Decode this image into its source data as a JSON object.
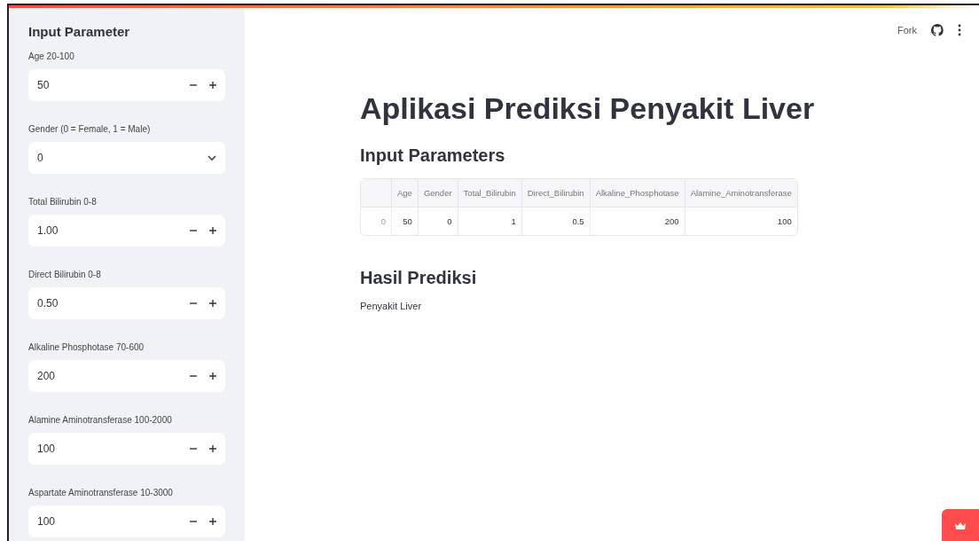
{
  "sidebar": {
    "title": "Input Parameter",
    "fields": [
      {
        "label": "Age 20-100",
        "value": "50",
        "kind": "number"
      },
      {
        "label": "Gender (0 = Female, 1 = Male)",
        "value": "0",
        "kind": "select"
      },
      {
        "label": "Total Bilirubin 0-8",
        "value": "1.00",
        "kind": "number"
      },
      {
        "label": "Direct Bilirubin 0-8",
        "value": "0.50",
        "kind": "number"
      },
      {
        "label": "Alkaline Phosphotase 70-600",
        "value": "200",
        "kind": "number"
      },
      {
        "label": "Alamine Aminotransferase 100-2000",
        "value": "100",
        "kind": "number"
      },
      {
        "label": "Aspartate Aminotransferase 10-3000",
        "value": "100",
        "kind": "number"
      }
    ]
  },
  "toolbar": {
    "fork": "Fork"
  },
  "main": {
    "title": "Aplikasi Prediksi Penyakit Liver",
    "subtitle": "Input Parameters",
    "table": {
      "columns": [
        "Age",
        "Gender",
        "Total_Bilirubin",
        "Direct_Bilirubin",
        "Alkaline_Phosphotase",
        "Alamine_Aminotransferase"
      ],
      "rows": [
        {
          "index": "0",
          "cells": [
            "50",
            "0",
            "1",
            "0.5",
            "200",
            "100"
          ]
        }
      ]
    },
    "result_heading": "Hasil Prediksi",
    "result": "Penyakit Liver"
  }
}
